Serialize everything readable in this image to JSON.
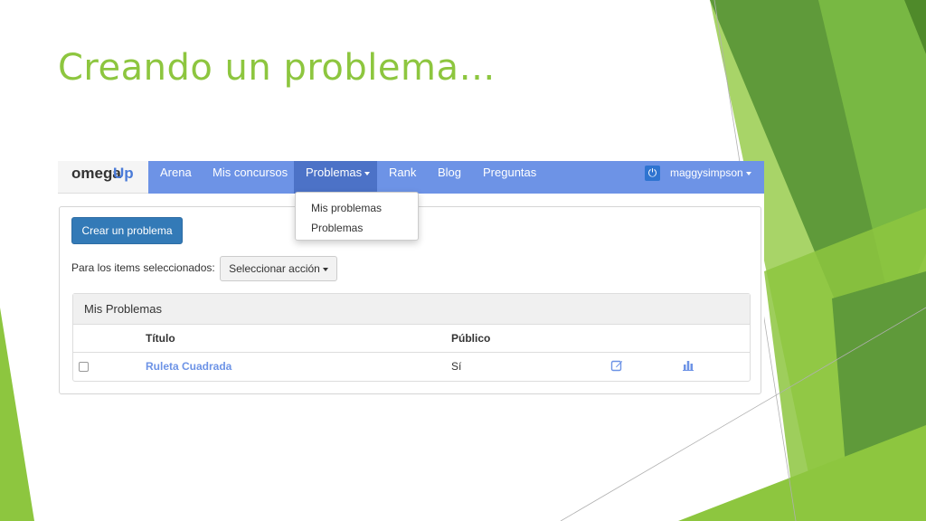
{
  "slide": {
    "title": "Creando un problema…"
  },
  "app": {
    "brand": {
      "part1": "omega",
      "part2": "Up"
    },
    "nav": {
      "items": [
        {
          "label": "Arena"
        },
        {
          "label": "Mis concursos"
        },
        {
          "label": "Problemas"
        },
        {
          "label": "Rank"
        },
        {
          "label": "Blog"
        },
        {
          "label": "Preguntas"
        }
      ],
      "user": "maggysimpson"
    },
    "dropdown": {
      "items": [
        "Mis problemas",
        "Problemas"
      ]
    },
    "create_button": "Crear un problema",
    "bulk_label": "Para los items seleccionados:",
    "bulk_select": "Seleccionar acción",
    "table": {
      "title": "Mis Problemas",
      "headers": [
        "Título",
        "Público"
      ],
      "rows": [
        {
          "title": "Ruleta Cuadrada",
          "public": "Sí"
        }
      ]
    }
  },
  "colors": {
    "accent_green": "#8dc63f",
    "nav_blue": "#6d93e6",
    "primary_blue": "#337ab7"
  }
}
